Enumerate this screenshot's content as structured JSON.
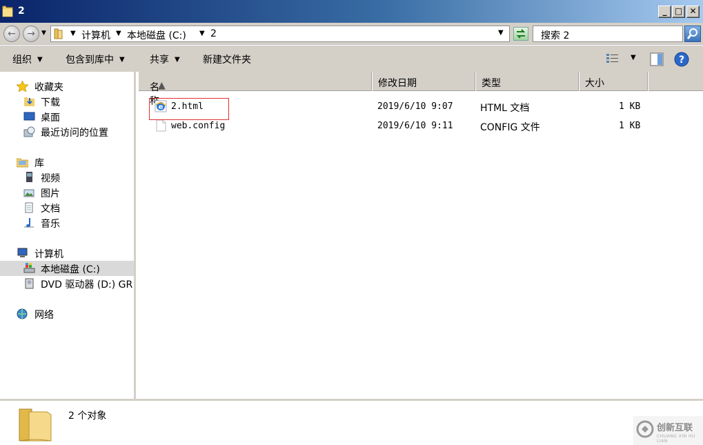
{
  "window": {
    "title": "2"
  },
  "address": {
    "crumbs": [
      "计算机",
      "本地磁盘 (C:)",
      "2"
    ]
  },
  "search": {
    "placeholder": "搜索 2"
  },
  "toolbar": {
    "organize": "组织",
    "include_in_library": "包含到库中",
    "share": "共享",
    "new_folder": "新建文件夹"
  },
  "nav": {
    "favorites": "收藏夹",
    "downloads": "下载",
    "desktop": "桌面",
    "recent": "最近访问的位置",
    "libraries": "库",
    "videos": "视频",
    "pictures": "图片",
    "documents": "文档",
    "music": "音乐",
    "computer": "计算机",
    "local_disk": "本地磁盘 (C:)",
    "dvd": "DVD 驱动器 (D:) GR",
    "network": "网络"
  },
  "columns": {
    "name": "名称",
    "modified": "修改日期",
    "type": "类型",
    "size": "大小"
  },
  "files": [
    {
      "name": "2.html",
      "modified": "2019/6/10 9:07",
      "type": "HTML 文档",
      "size": "1 KB",
      "icon": "ie-html-icon"
    },
    {
      "name": "web.config",
      "modified": "2019/6/10 9:11",
      "type": "CONFIG 文件",
      "size": "1 KB",
      "icon": "blank-file-icon"
    }
  ],
  "status": {
    "count": "2 个对象"
  },
  "watermark": {
    "text": "创新互联",
    "sub": "CHUANG XIN HU LIAN"
  },
  "colors": {
    "titlebar_start": "#0a246a",
    "titlebar_end": "#a6caf0",
    "chrome": "#d4d0c8",
    "highlight_box": "#e03030"
  }
}
